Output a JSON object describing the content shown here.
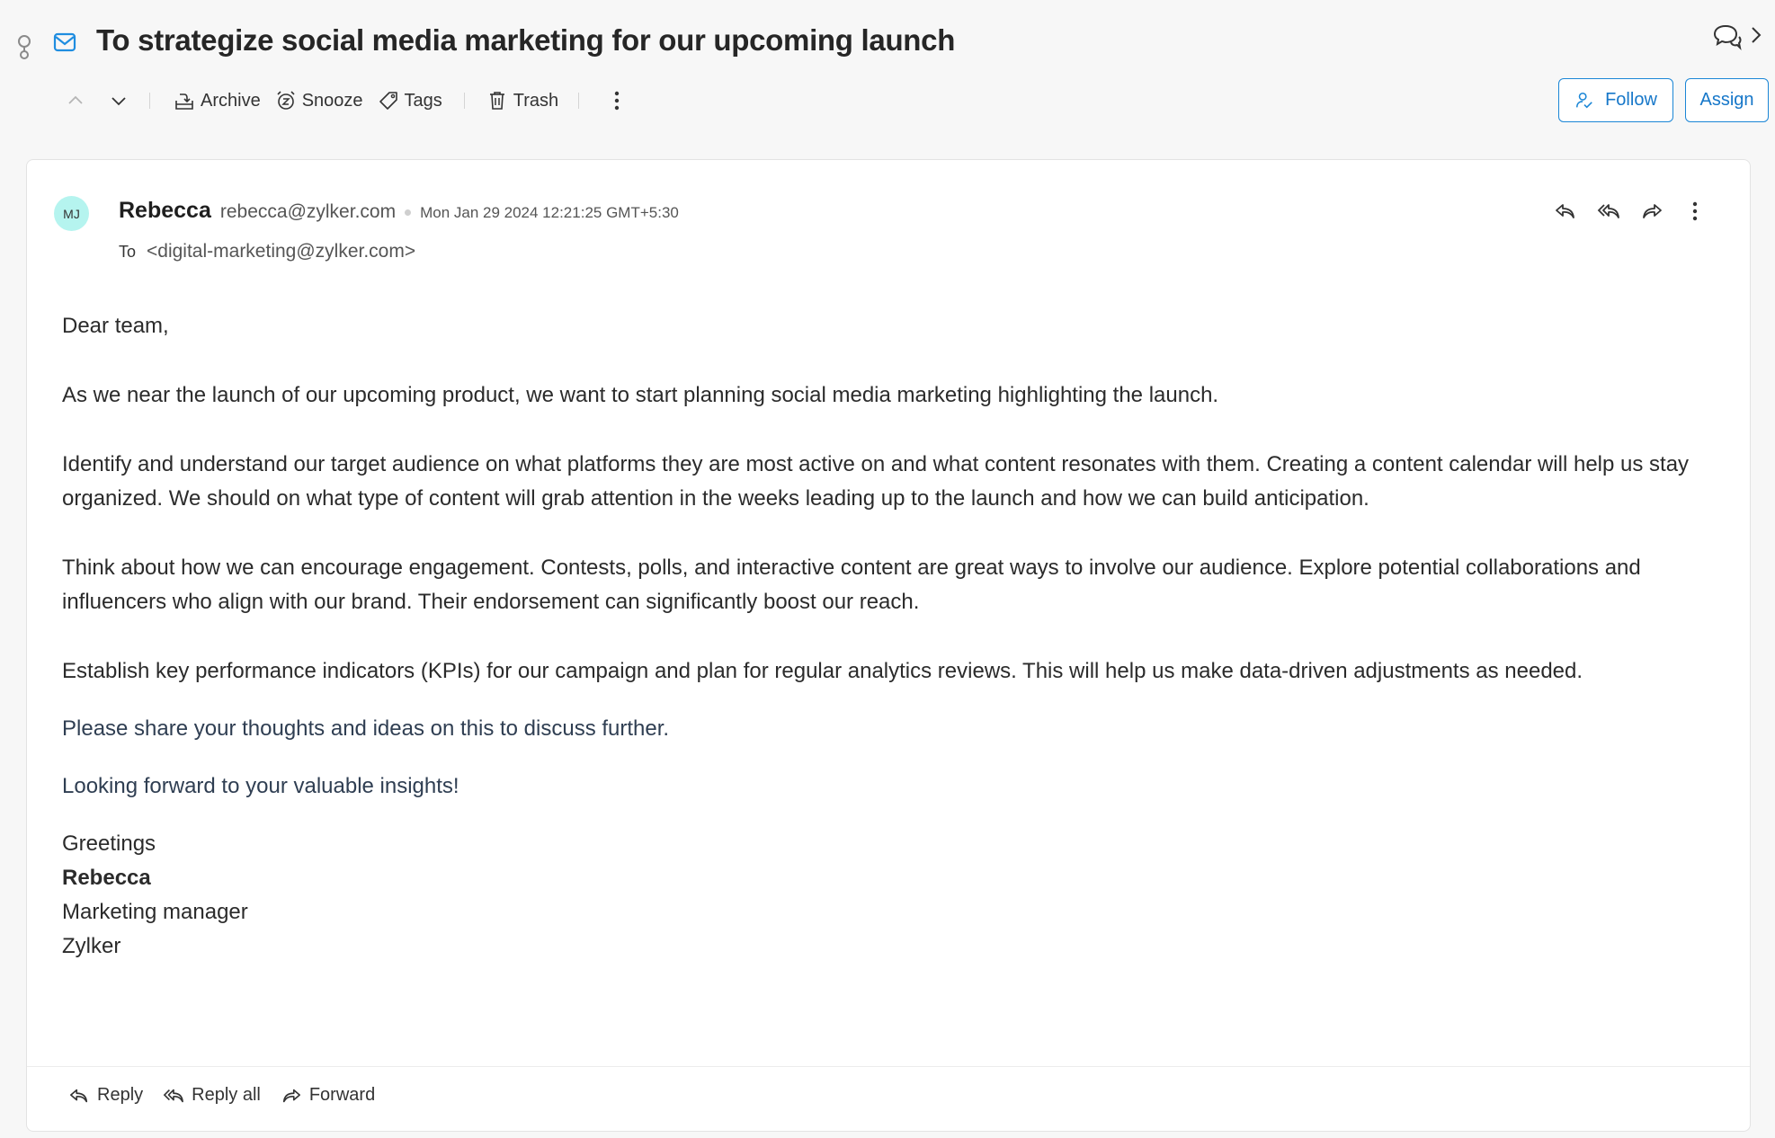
{
  "header": {
    "title": "To strategize social media marketing for our upcoming launch",
    "icons": {
      "pin": "pin-icon",
      "mail": "envelope-icon",
      "comments": "comments-icon",
      "expand": "chevron-right-icon"
    }
  },
  "toolbar": {
    "archive_label": "Archive",
    "snooze_label": "Snooze",
    "tags_label": "Tags",
    "trash_label": "Trash",
    "follow_label": "Follow",
    "assign_label": "Assign"
  },
  "message": {
    "avatar_initials": "MJ",
    "sender_name": "Rebecca",
    "sender_email": "rebecca@zylker.com",
    "date": "Mon Jan 29 2024 12:21:25 GMT+5:30",
    "to_label": "To",
    "to_address": "<digital-marketing@zylker.com>",
    "body": {
      "greeting": "Dear team,",
      "paragraphs": [
        "As we near the launch of our upcoming product, we want to start planning social media marketing highlighting the launch.",
        "Identify and understand our target audience on what platforms they are most active on and what content resonates with them. Creating a content calendar will help us stay organized. We should on what type of content will grab attention in the weeks leading up to the launch and how we can build anticipation.",
        "Think about how we can encourage engagement. Contests, polls, and interactive content are great ways to involve our audience. Explore potential collaborations and influencers who align with our brand. Their endorsement can significantly boost our reach.",
        "Establish key performance indicators (KPIs) for our campaign and plan for regular analytics reviews. This will help us make data-driven adjustments as needed."
      ],
      "closing_lines": [
        "Please share your thoughts and ideas on this to discuss further.",
        "Looking forward to your valuable insights!"
      ],
      "signature": {
        "salutation": "Greetings",
        "name": "Rebecca",
        "title": "Marketing manager",
        "company": "Zylker"
      }
    }
  },
  "footer": {
    "reply_label": "Reply",
    "reply_all_label": "Reply all",
    "forward_label": "Forward"
  },
  "colors": {
    "accent": "#1677c9",
    "avatar_bg": "#b5f4ef",
    "page_bg": "#f7f7f7"
  }
}
